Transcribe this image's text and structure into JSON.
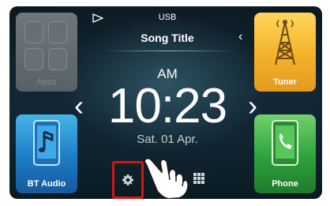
{
  "header": {
    "source_label": "USB",
    "song_title": "Song Title"
  },
  "clock": {
    "ampm": "AM",
    "time": "10:23",
    "date": "Sat. 01 Apr."
  },
  "tiles": {
    "apps_label": "Apps",
    "tuner_label": "Tuner",
    "bt_audio_label": "BT Audio",
    "phone_label": "Phone"
  },
  "colors": {
    "tuner": "#f3b12a",
    "bt_audio": "#1e7cc6",
    "phone": "#2da13c",
    "highlight": "#d61414"
  },
  "icons": {
    "play": "play-outline-icon",
    "chevron": "chevron-left-icon",
    "settings": "gear-icon",
    "menu": "grid-icon",
    "touch": "hand-pointer-icon"
  }
}
